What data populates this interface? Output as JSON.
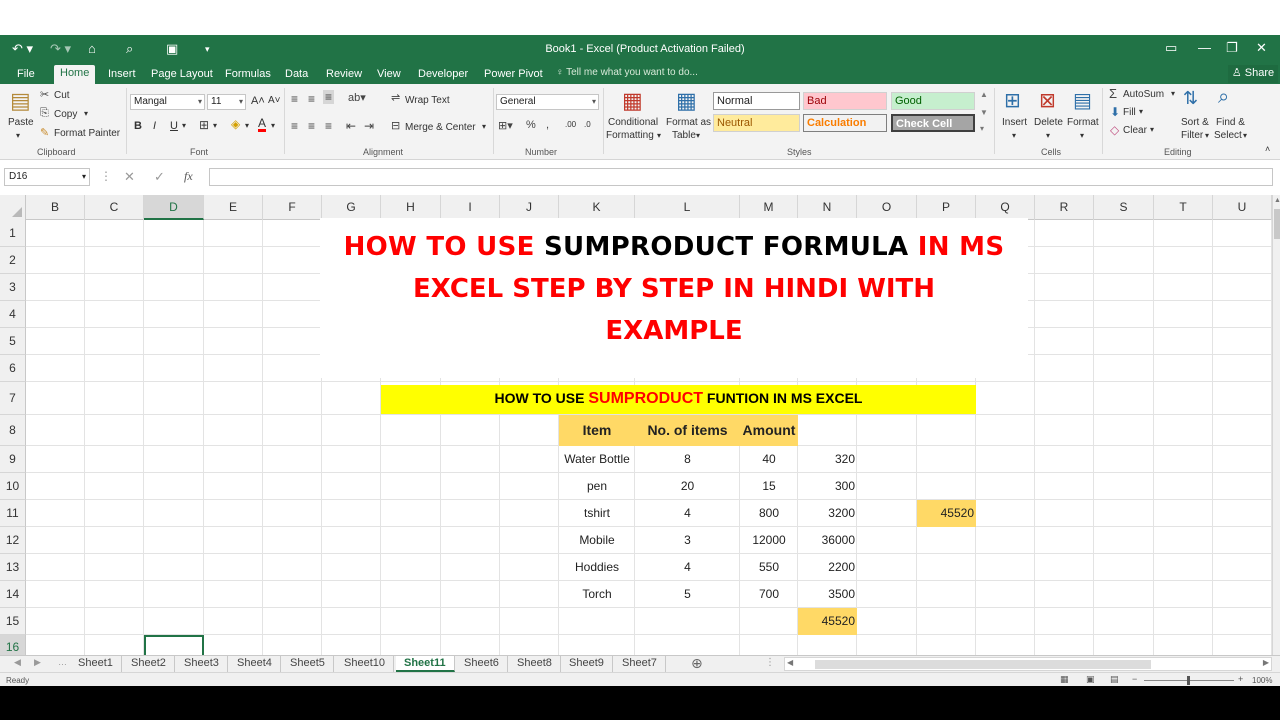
{
  "titlebar": {
    "title": "Book1 - Excel (Product Activation Failed)",
    "undo_icon": "undo-icon",
    "redo_icon": "redo-icon",
    "save_icon": "save-icon"
  },
  "tabs": {
    "file": "File",
    "home": "Home",
    "insert": "Insert",
    "page_layout": "Page Layout",
    "formulas": "Formulas",
    "data": "Data",
    "review": "Review",
    "view": "View",
    "developer": "Developer",
    "power_pivot": "Power Pivot",
    "tell_me": "Tell me what you want to do...",
    "share": "Share"
  },
  "ribbon": {
    "clipboard": {
      "paste": "Paste",
      "cut": "Cut",
      "copy": "Copy",
      "format_painter": "Format Painter",
      "label": "Clipboard"
    },
    "font": {
      "name": "Mangal",
      "size": "11",
      "bold": "B",
      "italic": "I",
      "underline": "U",
      "label": "Font"
    },
    "alignment": {
      "wrap_text": "Wrap Text",
      "merge_center": "Merge & Center",
      "label": "Alignment"
    },
    "number": {
      "format": "General",
      "label": "Number"
    },
    "styles": {
      "conditional": "Conditional",
      "conditional2": "Formatting",
      "format_as": "Format as",
      "format_as2": "Table",
      "normal": "Normal",
      "bad": "Bad",
      "good": "Good",
      "neutral": "Neutral",
      "calculation": "Calculation",
      "check_cell": "Check Cell",
      "label": "Styles"
    },
    "cells": {
      "insert": "Insert",
      "delete": "Delete",
      "format": "Format",
      "label": "Cells"
    },
    "editing": {
      "autosum": "AutoSum",
      "fill": "Fill",
      "clear": "Clear",
      "sort": "Sort &",
      "sort2": "Filter",
      "find": "Find &",
      "find2": "Select",
      "label": "Editing"
    }
  },
  "formula_bar": {
    "name_box": "D16",
    "fx": "fx",
    "value": ""
  },
  "columns": [
    "B",
    "C",
    "D",
    "E",
    "F",
    "G",
    "H",
    "I",
    "J",
    "K",
    "L",
    "M",
    "N",
    "O",
    "P",
    "Q",
    "R",
    "S",
    "T",
    "U"
  ],
  "rows": [
    "1",
    "2",
    "3",
    "4",
    "5",
    "6",
    "7",
    "8",
    "9",
    "10",
    "11",
    "12",
    "13",
    "14",
    "15",
    "16"
  ],
  "content": {
    "title_line1_a": "HOW TO USE ",
    "title_line1_b": "SUMPRODUCT FORMULA ",
    "title_line1_c": "IN MS",
    "title_line2": "EXCEL STEP BY STEP IN HINDI WITH",
    "title_line3": "EXAMPLE",
    "banner_a": "HOW  TO  USE  ",
    "banner_b": "SUMPRODUCT",
    "banner_c": "  FUNTION  IN  MS  EXCEL",
    "table_headers": [
      "Item",
      "No.  of  items",
      "Amount"
    ],
    "table_rows": [
      [
        "Water  Bottle",
        "8",
        "40",
        "320"
      ],
      [
        "pen",
        "20",
        "15",
        "300"
      ],
      [
        "tshirt",
        "4",
        "800",
        "3200"
      ],
      [
        "Mobile",
        "3",
        "12000",
        "36000"
      ],
      [
        "Hoddies",
        "4",
        "550",
        "2200"
      ],
      [
        "Torch",
        "5",
        "700",
        "3500"
      ]
    ],
    "total_n15": "45520",
    "total_p11": "45520"
  },
  "colors": {
    "excel_green": "#217346",
    "title_red": "#ff0000",
    "banner_yellow": "#ffff00",
    "header_orange": "#ffd966"
  },
  "sheets": [
    "Sheet1",
    "Sheet2",
    "Sheet3",
    "Sheet4",
    "Sheet5",
    "Sheet10",
    "Sheet11",
    "Sheet6",
    "Sheet8",
    "Sheet9",
    "Sheet7"
  ],
  "active_sheet": "Sheet11",
  "status": {
    "ready": "Ready",
    "zoom": "100%"
  }
}
